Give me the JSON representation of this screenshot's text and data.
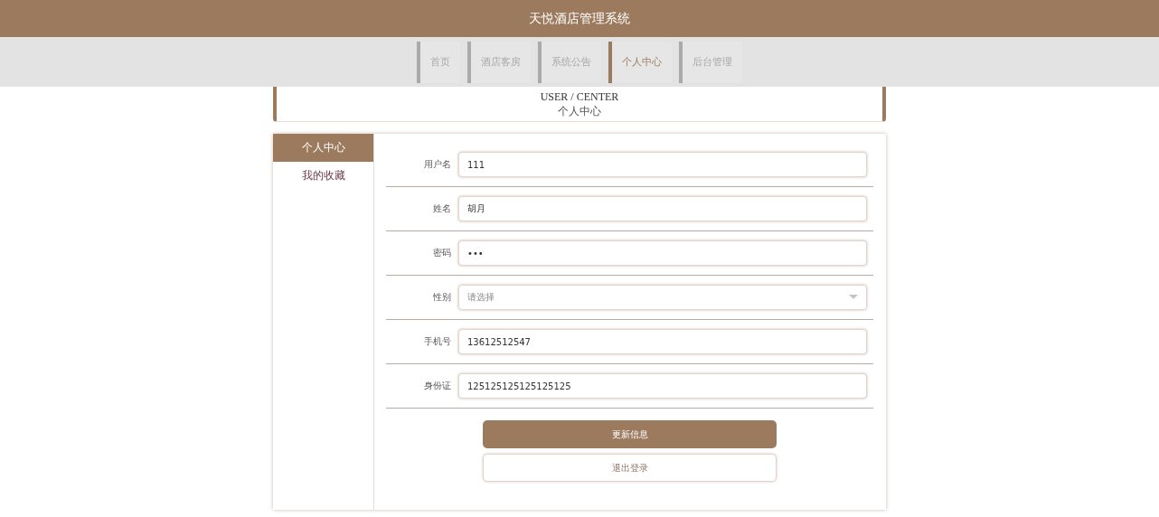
{
  "header": {
    "title": "天悦酒店管理系统"
  },
  "nav": [
    {
      "label": "首页",
      "selected": false
    },
    {
      "label": "酒店客房",
      "selected": false
    },
    {
      "label": "系统公告",
      "selected": false
    },
    {
      "label": "个人中心",
      "selected": true
    },
    {
      "label": "后台管理",
      "selected": false
    }
  ],
  "banner": {
    "subtitle_en": "USER / CENTER",
    "title": "个人中心"
  },
  "sidebar": {
    "items": [
      {
        "label": "个人中心",
        "selected": true
      },
      {
        "label": "我的收藏",
        "selected": false
      }
    ]
  },
  "form": {
    "fields": [
      {
        "kind": "text",
        "label": "用户名",
        "value": "111"
      },
      {
        "kind": "text",
        "label": "姓名",
        "value": "胡月"
      },
      {
        "kind": "text",
        "label": "密码",
        "value": "•••"
      },
      {
        "kind": "select",
        "label": "性别",
        "placeholder": "请选择"
      },
      {
        "kind": "text",
        "label": "手机号",
        "value": "13612512547"
      },
      {
        "kind": "text",
        "label": "身份证",
        "value": "125125125125125125"
      }
    ],
    "buttons": [
      {
        "kind": "primary",
        "label": "更新信息"
      },
      {
        "kind": "secondary",
        "label": "退出登录"
      }
    ]
  }
}
